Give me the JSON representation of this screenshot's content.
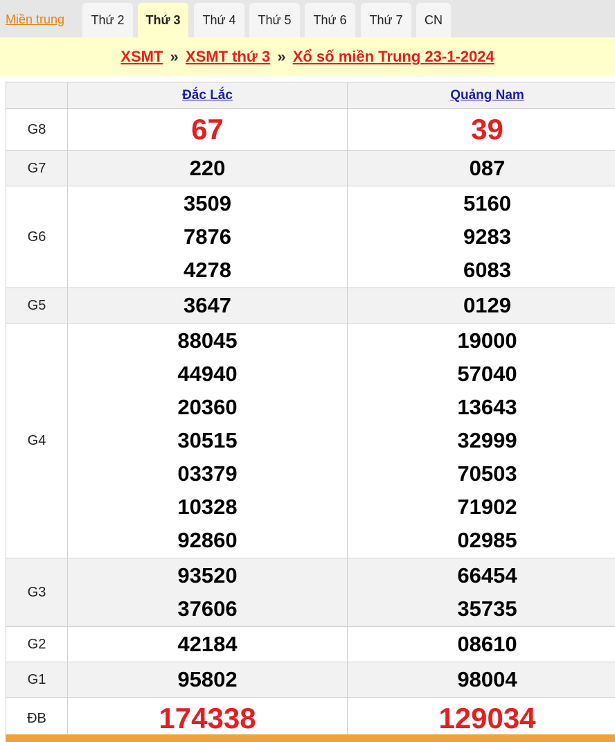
{
  "tabs": {
    "home": "Miền trung",
    "days": [
      "Thứ 2",
      "Thứ 3",
      "Thứ 4",
      "Thứ 5",
      "Thứ 6",
      "Thứ 7",
      "CN"
    ],
    "active": "Thứ 3"
  },
  "breadcrumb": {
    "part1": "XSMT",
    "part2": "XSMT thứ 3",
    "part3": "Xổ số miền Trung 23-1-2024",
    "separator": "»"
  },
  "table": {
    "provinces": [
      "Đắc Lắc",
      "Quảng Nam"
    ],
    "rows": [
      {
        "prize": "G8",
        "a": [
          "67"
        ],
        "b": [
          "39"
        ],
        "highlight": true
      },
      {
        "prize": "G7",
        "a": [
          "220"
        ],
        "b": [
          "087"
        ]
      },
      {
        "prize": "G6",
        "a": [
          "3509",
          "7876",
          "4278"
        ],
        "b": [
          "5160",
          "9283",
          "6083"
        ]
      },
      {
        "prize": "G5",
        "a": [
          "3647"
        ],
        "b": [
          "0129"
        ]
      },
      {
        "prize": "G4",
        "a": [
          "88045",
          "44940",
          "20360",
          "30515",
          "03379",
          "10328",
          "92860"
        ],
        "b": [
          "19000",
          "57040",
          "13643",
          "32999",
          "70503",
          "71902",
          "02985"
        ]
      },
      {
        "prize": "G3",
        "a": [
          "93520",
          "37606"
        ],
        "b": [
          "66454",
          "35735"
        ]
      },
      {
        "prize": "G2",
        "a": [
          "42184"
        ],
        "b": [
          "08610"
        ]
      },
      {
        "prize": "G1",
        "a": [
          "95802"
        ],
        "b": [
          "98004"
        ]
      },
      {
        "prize": "ĐB",
        "a": [
          "174338"
        ],
        "b": [
          "129034"
        ],
        "highlight": true
      }
    ]
  },
  "colors": {
    "accent_red": "#e31f1f",
    "link_blue": "#1b1fa8",
    "title_bg": "#ffffcc",
    "home_orange": "#e8820e"
  }
}
